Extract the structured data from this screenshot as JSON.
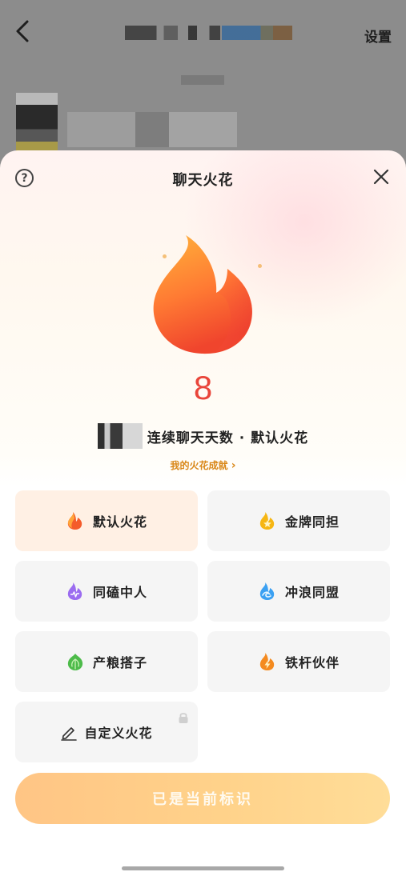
{
  "background": {
    "settings_label": "设置"
  },
  "sheet": {
    "title": "聊天火花",
    "count": "8",
    "days_text": "连续聊天天数 · 默认火花",
    "achievement_link": "我的火花成就",
    "chevron": "›",
    "options": [
      {
        "label": "默认火花",
        "icon": "fire-default-icon",
        "color": "#f45b2b",
        "selected": true
      },
      {
        "label": "金牌同担",
        "icon": "fire-gold-medal-icon",
        "color": "#f6b613",
        "selected": false
      },
      {
        "label": "同磕中人",
        "icon": "fire-purple-heartbeat-icon",
        "color": "#9b6cf0",
        "selected": false
      },
      {
        "label": "冲浪同盟",
        "icon": "fire-blue-wave-icon",
        "color": "#3ba0f2",
        "selected": false
      },
      {
        "label": "产粮搭子",
        "icon": "fire-green-leaf-icon",
        "color": "#4dbb4a",
        "selected": false
      },
      {
        "label": "铁杆伙伴",
        "icon": "fire-orange-bolt-icon",
        "color": "#f48a1f",
        "selected": false
      },
      {
        "label": "自定义火花",
        "icon": "pencil-icon",
        "color": "#333333",
        "selected": false,
        "locked": true
      }
    ],
    "cta_label": "已是当前标识"
  },
  "colors": {
    "accent_count": "#e9453a",
    "link": "#d98718"
  }
}
